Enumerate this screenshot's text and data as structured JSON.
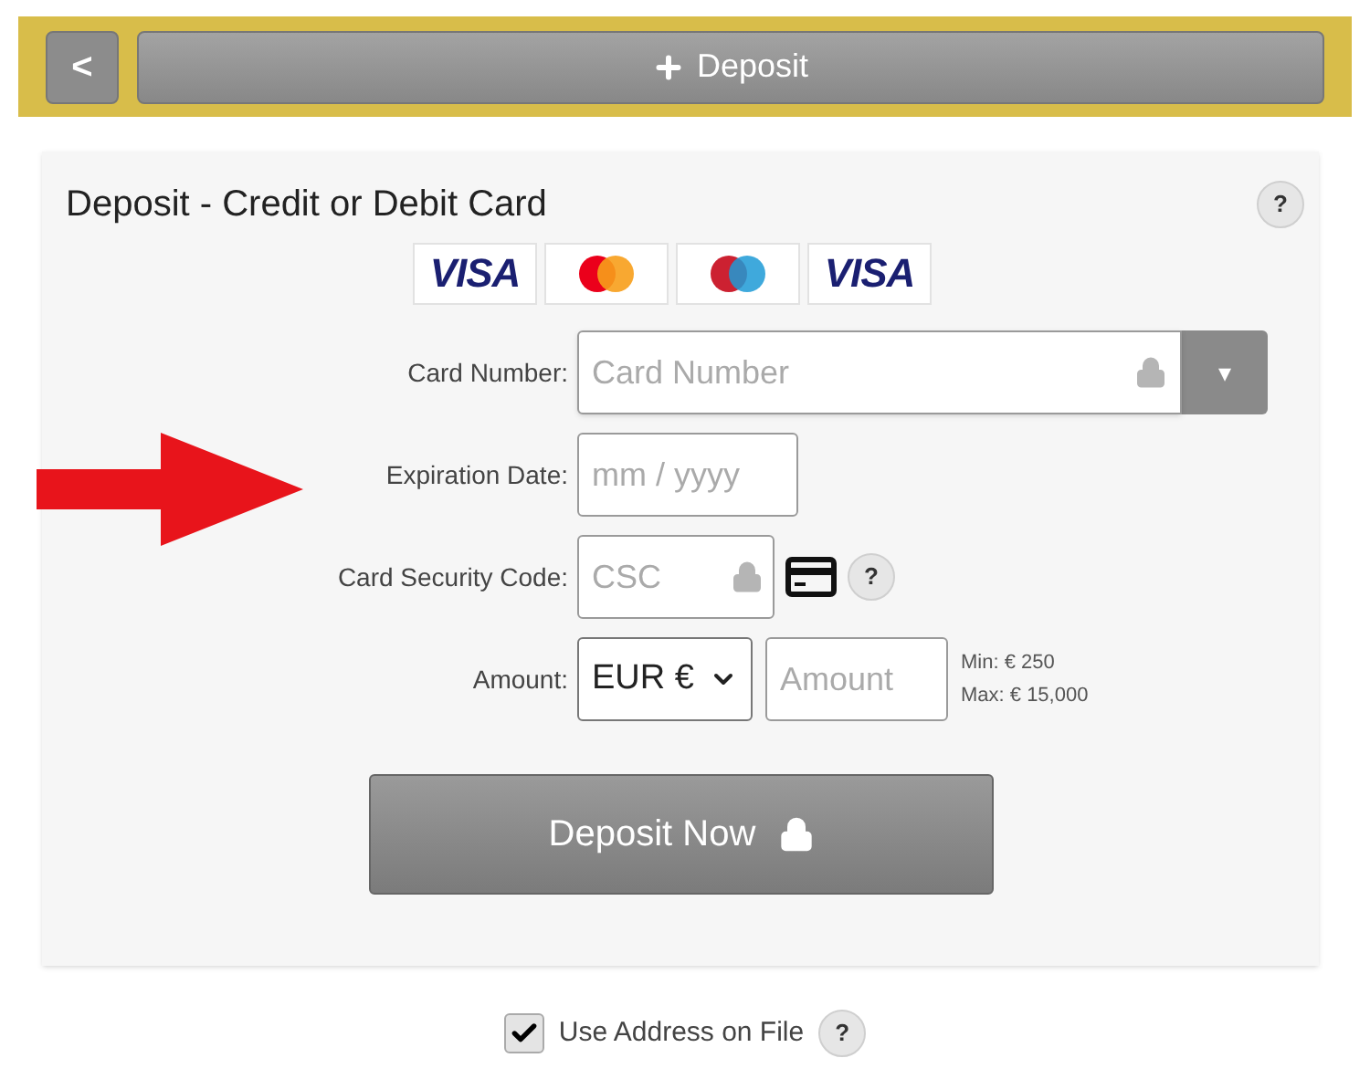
{
  "header": {
    "back_label": "<",
    "button_label": "Deposit"
  },
  "panel": {
    "title": "Deposit - Credit or Debit Card",
    "help": "?"
  },
  "card_logos": [
    {
      "kind": "visa",
      "label": "VISA"
    },
    {
      "kind": "mastercard"
    },
    {
      "kind": "maestro"
    },
    {
      "kind": "visa-electron",
      "label": "VISA"
    }
  ],
  "fields": [
    {
      "kind": "card-number",
      "label": "Card Number:",
      "placeholder": "Card Number",
      "dropdown": "▾"
    },
    {
      "kind": "expiry",
      "label": "Expiration Date:",
      "placeholder": "mm / yyyy"
    },
    {
      "kind": "csc",
      "label": "Card Security Code:",
      "placeholder": "CSC",
      "help": "?"
    },
    {
      "kind": "amount",
      "label": "Amount:",
      "currency": "EUR €",
      "placeholder": "Amount",
      "min": "Min: € 250",
      "max": "Max: € 15,000"
    }
  ],
  "submit": {
    "label": "Deposit Now"
  },
  "address": {
    "label": "Use Address on File",
    "checked": true,
    "help": "?"
  }
}
